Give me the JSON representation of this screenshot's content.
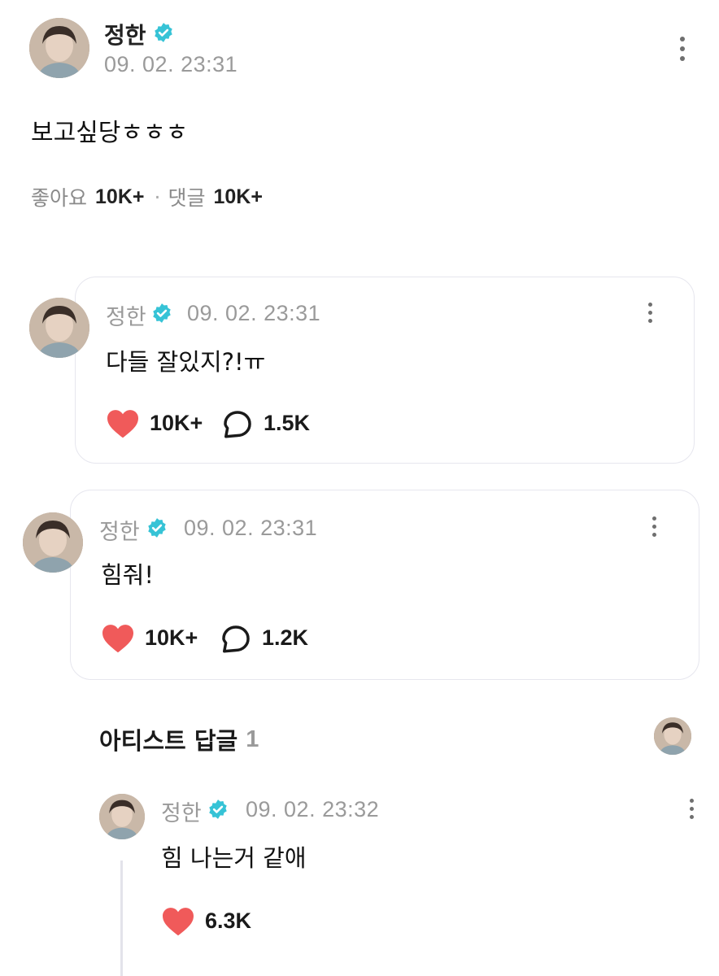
{
  "post": {
    "author": "정한",
    "timestamp": "09. 02. 23:31",
    "body": "보고싶당ㅎㅎㅎ",
    "likes_label": "좋아요",
    "likes_count": "10K+",
    "separator": "·",
    "comments_label": "댓글",
    "comments_count": "10K+"
  },
  "comments": [
    {
      "author": "정한",
      "timestamp": "09. 02. 23:31",
      "body": "다들 잘있지?!ㅠ",
      "likes": "10K+",
      "replies": "1.5K"
    },
    {
      "author": "정한",
      "timestamp": "09. 02. 23:31",
      "body": "힘줘!",
      "likes": "10K+",
      "replies": "1.2K"
    }
  ],
  "artist_replies": {
    "label": "아티스트 답글",
    "count": "1",
    "reply": {
      "author": "정한",
      "timestamp": "09. 02. 23:32",
      "body": "힘 나는거 같애",
      "likes": "6.3K"
    }
  },
  "icons": {
    "verified": "verified-badge-icon",
    "more": "more-vertical-icon",
    "like": "heart-icon",
    "comment": "comment-bubble-icon"
  },
  "colors": {
    "verified": "#36c3d6",
    "heart": "#f05a5a",
    "muted_text": "#9a9a9a",
    "card_border": "#e6e6ee"
  }
}
